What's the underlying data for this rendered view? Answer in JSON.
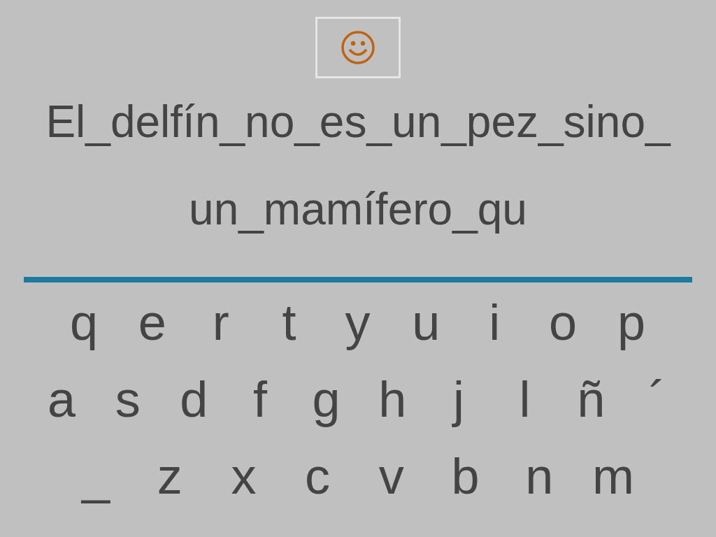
{
  "sentence_lines": [
    "El_delfín_no_es_un_pez_sino_",
    "un_mamífero_qu"
  ],
  "keyboard_rows": [
    [
      "q",
      "e",
      "r",
      "t",
      "y",
      "u",
      "i",
      "o",
      "p"
    ],
    [
      "a",
      "s",
      "d",
      "f",
      "g",
      "h",
      "j",
      "l",
      "ñ",
      "´"
    ],
    [
      "_",
      "z",
      "x",
      "c",
      "v",
      "b",
      "n",
      "m"
    ]
  ]
}
